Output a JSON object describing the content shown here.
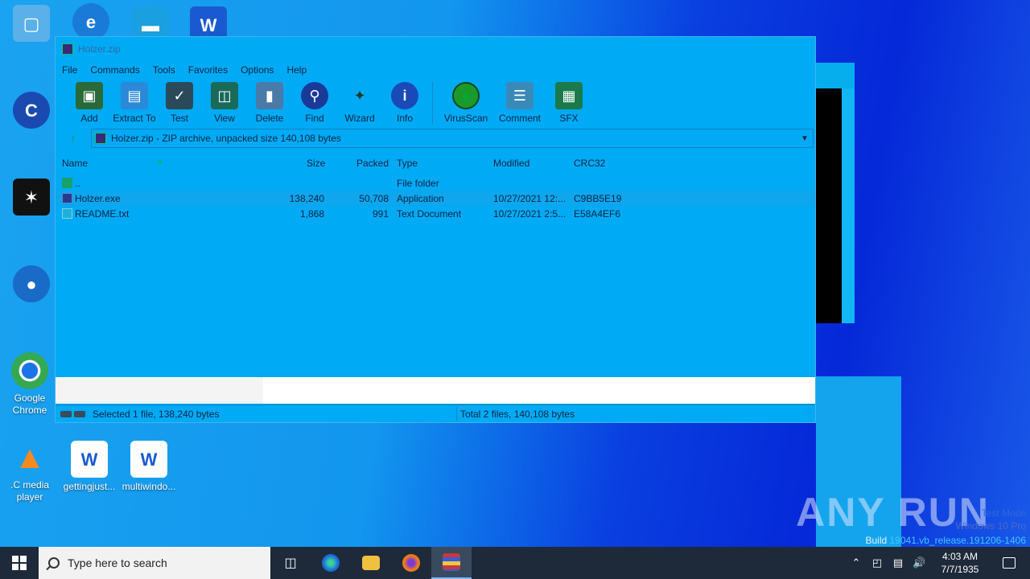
{
  "window": {
    "title": "Holzer.zip"
  },
  "menu": [
    "File",
    "Commands",
    "Tools",
    "Favorites",
    "Options",
    "Help"
  ],
  "toolbar": [
    {
      "label": "Add",
      "icon": "add-archive-icon",
      "color": "#2a6a3a"
    },
    {
      "label": "Extract To",
      "icon": "folder-extract-icon",
      "color": "#2a8ad8"
    },
    {
      "label": "Test",
      "icon": "clipboard-check-icon",
      "color": "#2a4a5a"
    },
    {
      "label": "View",
      "icon": "open-book-icon",
      "color": "#1a6a5a"
    },
    {
      "label": "Delete",
      "icon": "trash-icon",
      "color": "#4a7aa8"
    },
    {
      "label": "Find",
      "icon": "magnifier-icon",
      "color": "#1a3a9a"
    },
    {
      "label": "Wizard",
      "icon": "magic-wand-icon",
      "color": "#1a8a3a"
    },
    {
      "label": "Info",
      "icon": "info-icon",
      "color": "#1a4ab8"
    }
  ],
  "toolbar_extra": [
    {
      "label": "VirusScan",
      "icon": "virus-scan-icon",
      "color": "#1a9a2a"
    },
    {
      "label": "Comment",
      "icon": "comment-icon",
      "color": "#3a8ab8"
    },
    {
      "label": "SFX",
      "icon": "sfx-archive-icon",
      "color": "#1a7a4a"
    }
  ],
  "address": "Holzer.zip - ZIP archive, unpacked size 140,108 bytes",
  "columns": {
    "name": "Name",
    "size": "Size",
    "packed": "Packed",
    "type": "Type",
    "modified": "Modified",
    "crc": "CRC32"
  },
  "files": [
    {
      "name": "..",
      "size": "",
      "packed": "",
      "type": "File folder",
      "modified": "",
      "crc": ""
    },
    {
      "name": "Holzer.exe",
      "size": "138,240",
      "packed": "50,708",
      "type": "Application",
      "modified": "10/27/2021 12:...",
      "crc": "C9BB5E19"
    },
    {
      "name": "README.txt",
      "size": "1,868",
      "packed": "991",
      "type": "Text Document",
      "modified": "10/27/2021 2:5...",
      "crc": "E58A4EF6"
    }
  ],
  "status": {
    "left": "Selected 1 file, 138,240 bytes",
    "right": "Total 2 files, 140,108 bytes"
  },
  "desktop_icons": [
    {
      "label": "Google Chrome",
      "icon": "chrome-icon"
    },
    {
      "label": ".C media player",
      "icon": "vlc-icon"
    },
    {
      "label": "gettingjust...",
      "icon": "word-doc-icon"
    },
    {
      "label": "multiwindo...",
      "icon": "word-doc-icon"
    }
  ],
  "watermark": {
    "brand": "ANY RUN",
    "mode": "Test Mode",
    "edition": "Windows 10 Pro",
    "build_prefix": "Build",
    "build": "19041.vb_release.191206-1406"
  },
  "taskbar": {
    "search_placeholder": "Type here to search",
    "time": "4:03 AM",
    "date": "7/7/1935"
  }
}
